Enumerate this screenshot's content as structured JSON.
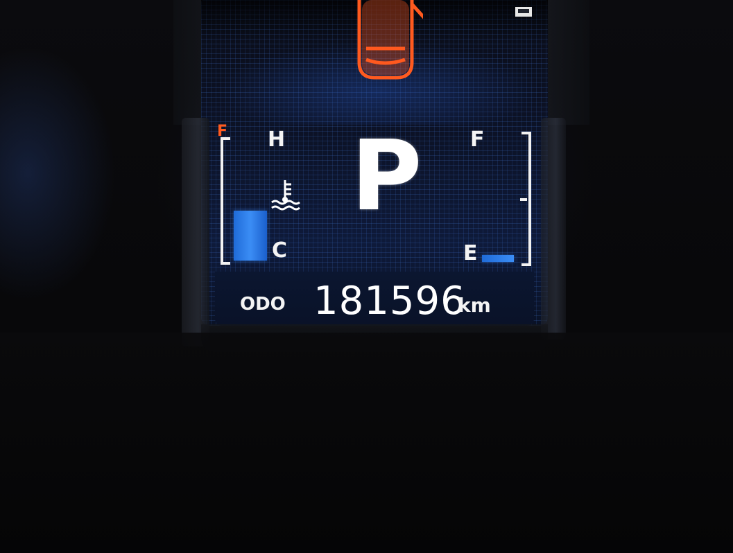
{
  "instrument_cluster": {
    "gear": "P",
    "temperature_gauge": {
      "high_label": "H",
      "low_label": "C",
      "level": 0.4,
      "icon": "coolant-temperature-icon"
    },
    "fuel_gauge": {
      "full_label": "F",
      "empty_label": "E",
      "level": 0.06
    },
    "odometer": {
      "label": "ODO",
      "value": "181596",
      "unit": "km"
    },
    "warnings": {
      "door_open_icon": "car-door-open-icon",
      "warning_color": "#ff5a1f"
    },
    "display_colors": {
      "bar_color": "#3b8df5",
      "text_color": "#ffffff"
    }
  }
}
